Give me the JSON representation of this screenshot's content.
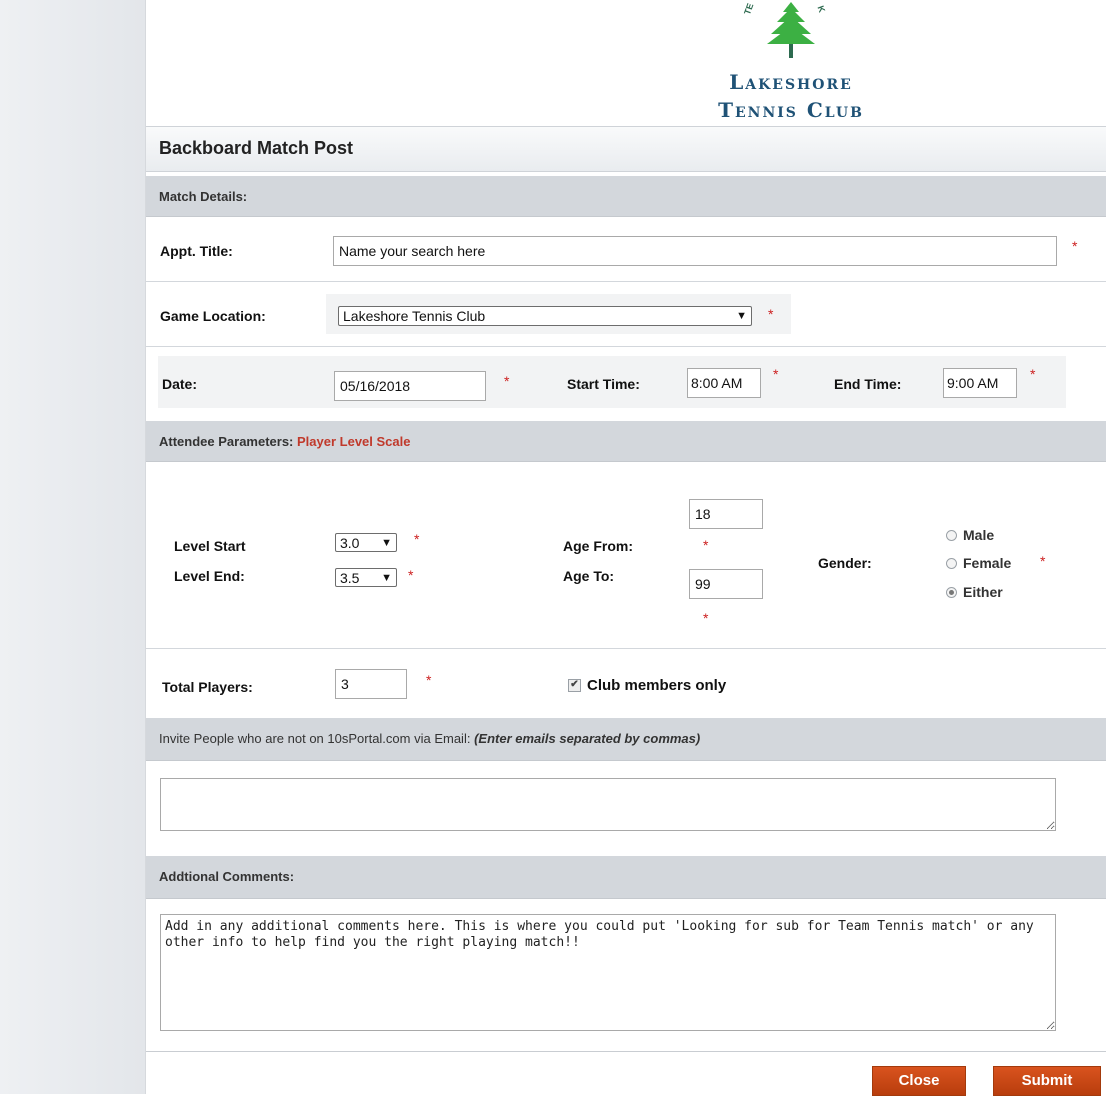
{
  "logo": {
    "arc_left": "TE",
    "arc_right": "K",
    "line1": "Lakeshore",
    "line2": "Tennis Club",
    "tree_color": "#3cb043"
  },
  "page_title": "Backboard Match Post",
  "sections": {
    "match_details": "Match Details:",
    "attendee_prefix": "Attendee Parameters:",
    "attendee_link": "Player Level Scale",
    "invite_prefix": "Invite People who are not on 10sPortal.com via Email:",
    "invite_hint": "(Enter emails separated by commas)",
    "comments": "Addtional Comments:"
  },
  "fields": {
    "appt_title_label": "Appt. Title:",
    "appt_title_value": "Name your search here",
    "location_label": "Game Location:",
    "location_value": "Lakeshore Tennis Club",
    "date_label": "Date:",
    "date_value": "05/16/2018",
    "start_label": "Start Time:",
    "start_value": "8:00 AM",
    "end_label": "End Time:",
    "end_value": "9:00 AM",
    "level_start_label": "Level Start",
    "level_start_value": "3.0",
    "level_end_label": "Level End:",
    "level_end_value": "3.5",
    "age_from_label": "Age From:",
    "age_from_value": "18",
    "age_to_label": "Age To:",
    "age_to_value": "99",
    "gender_label": "Gender:",
    "gender_options": [
      "Male",
      "Female",
      "Either"
    ],
    "gender_selected": "Either",
    "total_players_label": "Total Players:",
    "total_players_value": "3",
    "club_members_label": "Club members only",
    "club_members_checked": true,
    "invite_emails_value": "",
    "comments_value": "Add in any additional comments here. This is where you could put 'Looking for sub for Team Tennis match' or any other info to help find you the right playing match!!"
  },
  "required_mark": "*",
  "buttons": {
    "close": "Close",
    "submit": "Submit"
  },
  "colors": {
    "accent_button": "#c9461a",
    "required": "#cc1f1f",
    "link": "#c0392b",
    "section_bg": "#d3d7dc"
  }
}
